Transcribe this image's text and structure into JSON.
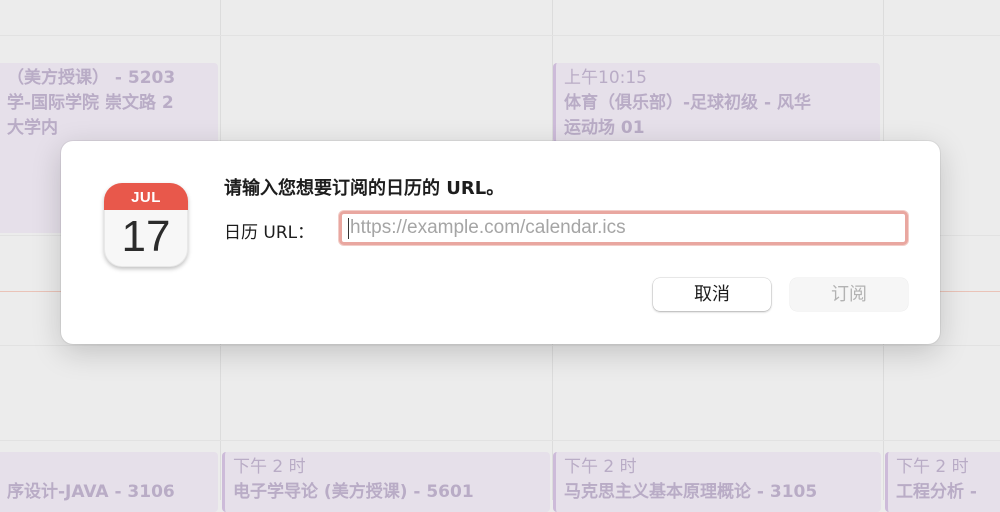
{
  "background_events": [
    {
      "time": "",
      "title": "（美方授课） - 5203",
      "lines": [
        "学-国际学院 崇文路 2",
        "大学内"
      ]
    },
    {
      "time": "上午10:15",
      "title": "体育（俱乐部）-足球初级 - 风华",
      "lines": [
        "运动场 01"
      ]
    },
    {
      "time": "",
      "title": "序设计-JAVA - 3106",
      "lines": []
    },
    {
      "time": "下午 2 时",
      "title": "电子学导论 (美方授课) - 5601",
      "lines": []
    },
    {
      "time": "下午 2 时",
      "title": "马克思主义基本原理概论 - 3105",
      "lines": []
    },
    {
      "time": "下午 2 时",
      "title": "工程分析 -",
      "lines": []
    }
  ],
  "dialog": {
    "icon": {
      "name": "calendar-app-icon",
      "month": "JUL",
      "day": "17"
    },
    "prompt": "请输入您想要订阅的日历的 URL。",
    "field_label": "日历 URL：",
    "url_input": {
      "value": "",
      "placeholder": "https://example.com/calendar.ics"
    },
    "cancel_label": "取消",
    "subscribe_label": "订阅"
  },
  "colors": {
    "accent_focus": "#e9a7a0",
    "calendar_red": "#e8584b",
    "event_fill": "#e6e0ea"
  }
}
